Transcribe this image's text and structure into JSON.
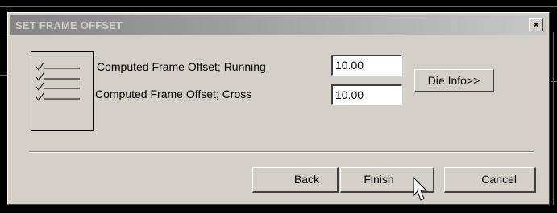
{
  "dialog": {
    "title": "SET FRAME OFFSET",
    "close_glyph": "×"
  },
  "fields": [
    {
      "label": "Computed Frame Offset; Running",
      "value": "10.00"
    },
    {
      "label": "Computed Frame Offset; Cross",
      "value": "10.00"
    }
  ],
  "buttons": {
    "die_info": "Die Info>>",
    "back": "Back",
    "finish": "Finish",
    "cancel": "Cancel"
  },
  "icons": {
    "checklist": "checklist-icon",
    "cursor": "mouse-pointer-icon"
  },
  "colors": {
    "dialog_face": "#d4d0c8",
    "titlebar_inactive": "#a8a8a8"
  }
}
